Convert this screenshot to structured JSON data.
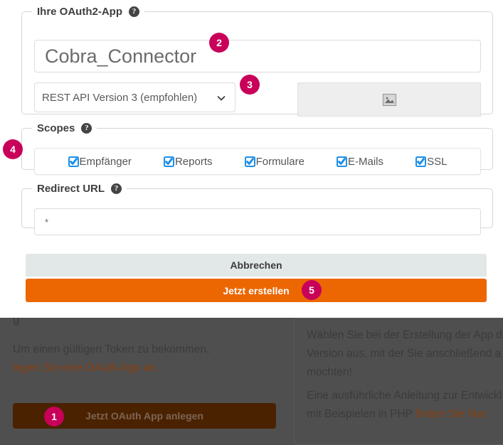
{
  "modal": {
    "app_group": {
      "legend": "Ihre OAuth2-App",
      "help_icon": "help-circle-icon",
      "app_name_value": "Cobra_Connector",
      "app_name_placeholder": "",
      "version_selected": "REST API Version 3 (empfohlen)",
      "version_options": [
        "REST API Version 3 (empfohlen)"
      ],
      "image_placeholder_icon": "broken-image-icon"
    },
    "scopes_group": {
      "legend": "Scopes",
      "help_icon": "help-circle-icon",
      "items": [
        {
          "label": "Empfänger",
          "checked": true
        },
        {
          "label": "Reports",
          "checked": true
        },
        {
          "label": "Formulare",
          "checked": true
        },
        {
          "label": "E-Mails",
          "checked": true
        },
        {
          "label": "SSL",
          "checked": true
        }
      ]
    },
    "redirect_group": {
      "legend": "Redirect URL",
      "help_icon": "help-circle-icon",
      "value": "*",
      "placeholder": ""
    },
    "buttons": {
      "cancel": "Abbrechen",
      "create": "Jetzt erstellen"
    }
  },
  "background": {
    "left_column": {
      "clipped_text": "g",
      "paragraph_plain": "Um einen gültigen Token zu bekommen,",
      "paragraph_link": "legen Sie eine OAuth-App an.",
      "button_label": "Jetzt OAuth App anlegen"
    },
    "right_column": {
      "paragraph_1": "Wählen Sie bei der Erstellung der App d",
      "paragraph_1_line2": "Version aus, mit der Sie anschließend a",
      "paragraph_1_line3": "möchten!",
      "paragraph_2": "Eine ausführliche Anleitung zur Entwickl",
      "paragraph_2_line2_plain": "mit Beispielen in PHP ",
      "paragraph_2_line2_link": "finden Sie hier."
    }
  },
  "badges": {
    "one": "1",
    "two": "2",
    "three": "3",
    "four": "4",
    "five": "5"
  },
  "colors": {
    "badge": "#C8005A",
    "primary_orange": "#EC6602",
    "cancel_gray": "#E2E7E7",
    "overlay_dark": "#4F4F4F",
    "checkbox_blue": "#1E90E8",
    "link_orange": "#8A4011"
  }
}
